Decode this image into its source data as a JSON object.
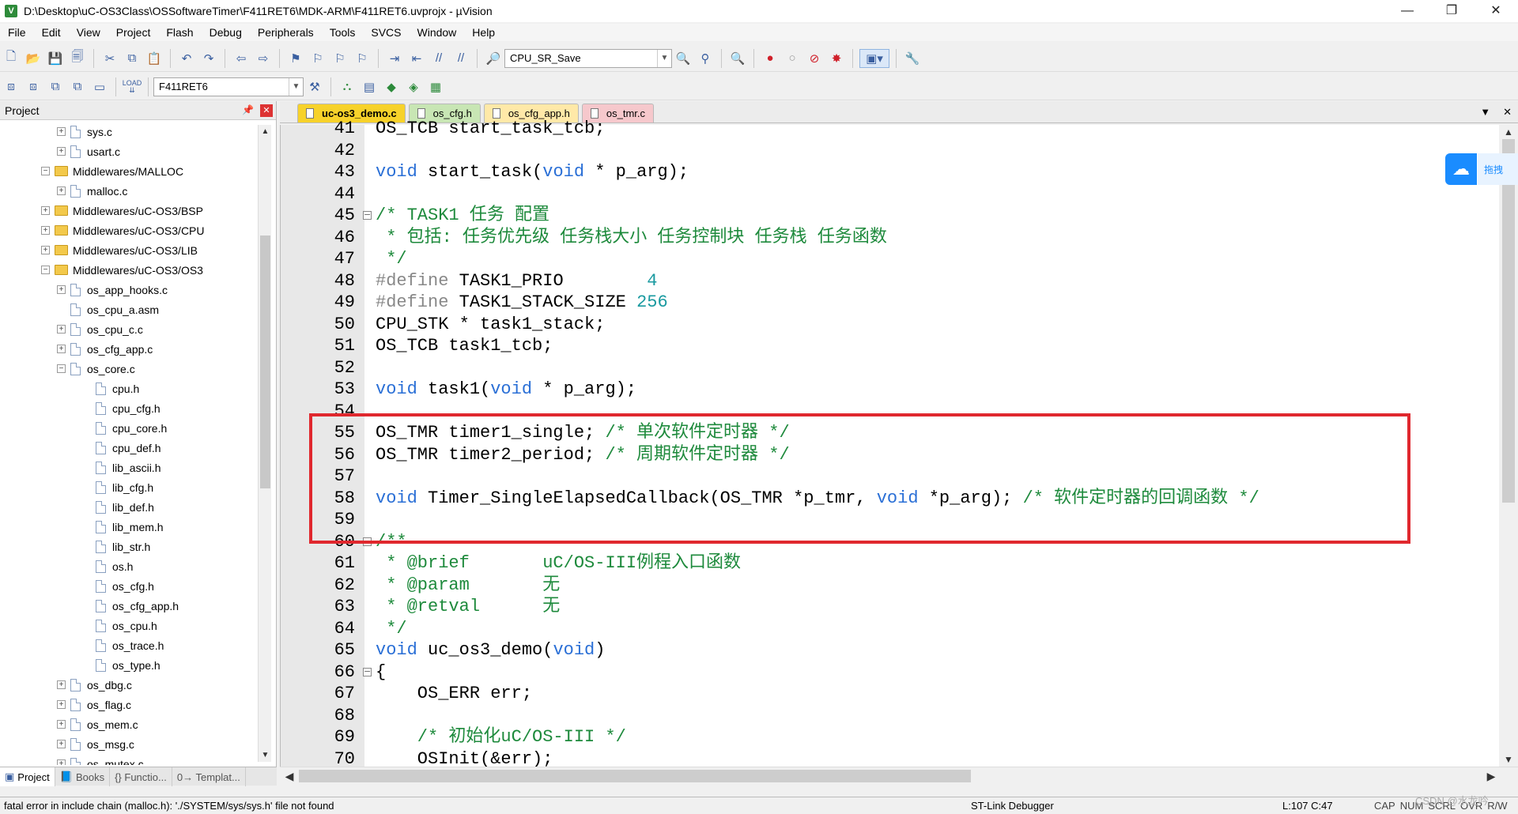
{
  "window": {
    "title": "D:\\Desktop\\uC-OS3Class\\OSSoftwareTimer\\F411RET6\\MDK-ARM\\F411RET6.uvprojx - µVision",
    "minimize": "—",
    "restore": "❐",
    "close": "✕"
  },
  "menu": [
    "File",
    "Edit",
    "View",
    "Project",
    "Flash",
    "Debug",
    "Peripherals",
    "Tools",
    "SVCS",
    "Window",
    "Help"
  ],
  "toolbar": {
    "find_combo_value": "CPU_SR_Save",
    "target_combo_value": "F411RET6",
    "load_label": "LOAD"
  },
  "project_panel": {
    "title": "Project",
    "tree": [
      {
        "label": "sys.c",
        "kind": "file",
        "level": 2,
        "exp": "+"
      },
      {
        "label": "usart.c",
        "kind": "file",
        "level": 2,
        "exp": "+"
      },
      {
        "label": "Middlewares/MALLOC",
        "kind": "folder",
        "level": 1,
        "exp": "-"
      },
      {
        "label": "malloc.c",
        "kind": "file",
        "level": 2,
        "exp": "+"
      },
      {
        "label": "Middlewares/uC-OS3/BSP",
        "kind": "folder",
        "level": 1,
        "exp": "+"
      },
      {
        "label": "Middlewares/uC-OS3/CPU",
        "kind": "folder",
        "level": 1,
        "exp": "+"
      },
      {
        "label": "Middlewares/uC-OS3/LIB",
        "kind": "folder",
        "level": 1,
        "exp": "+"
      },
      {
        "label": "Middlewares/uC-OS3/OS3",
        "kind": "folder",
        "level": 1,
        "exp": "-"
      },
      {
        "label": "os_app_hooks.c",
        "kind": "file",
        "level": 2,
        "exp": "+"
      },
      {
        "label": "os_cpu_a.asm",
        "kind": "file",
        "level": 2,
        "exp": ""
      },
      {
        "label": "os_cpu_c.c",
        "kind": "file",
        "level": 2,
        "exp": "+"
      },
      {
        "label": "os_cfg_app.c",
        "kind": "file",
        "level": 2,
        "exp": "+"
      },
      {
        "label": "os_core.c",
        "kind": "file",
        "level": 2,
        "exp": "-"
      },
      {
        "label": "cpu.h",
        "kind": "file",
        "level": 3,
        "exp": ""
      },
      {
        "label": "cpu_cfg.h",
        "kind": "file",
        "level": 3,
        "exp": ""
      },
      {
        "label": "cpu_core.h",
        "kind": "file",
        "level": 3,
        "exp": ""
      },
      {
        "label": "cpu_def.h",
        "kind": "file",
        "level": 3,
        "exp": ""
      },
      {
        "label": "lib_ascii.h",
        "kind": "file",
        "level": 3,
        "exp": ""
      },
      {
        "label": "lib_cfg.h",
        "kind": "file",
        "level": 3,
        "exp": ""
      },
      {
        "label": "lib_def.h",
        "kind": "file",
        "level": 3,
        "exp": ""
      },
      {
        "label": "lib_mem.h",
        "kind": "file",
        "level": 3,
        "exp": ""
      },
      {
        "label": "lib_str.h",
        "kind": "file",
        "level": 3,
        "exp": ""
      },
      {
        "label": "os.h",
        "kind": "file",
        "level": 3,
        "exp": ""
      },
      {
        "label": "os_cfg.h",
        "kind": "file",
        "level": 3,
        "exp": ""
      },
      {
        "label": "os_cfg_app.h",
        "kind": "file",
        "level": 3,
        "exp": ""
      },
      {
        "label": "os_cpu.h",
        "kind": "file",
        "level": 3,
        "exp": ""
      },
      {
        "label": "os_trace.h",
        "kind": "file",
        "level": 3,
        "exp": ""
      },
      {
        "label": "os_type.h",
        "kind": "file",
        "level": 3,
        "exp": ""
      },
      {
        "label": "os_dbg.c",
        "kind": "file",
        "level": 2,
        "exp": "+"
      },
      {
        "label": "os_flag.c",
        "kind": "file",
        "level": 2,
        "exp": "+"
      },
      {
        "label": "os_mem.c",
        "kind": "file",
        "level": 2,
        "exp": "+"
      },
      {
        "label": "os_msg.c",
        "kind": "file",
        "level": 2,
        "exp": "+"
      },
      {
        "label": "os_mutex.c",
        "kind": "file",
        "level": 2,
        "exp": "+"
      }
    ],
    "tabs": [
      "Project",
      "Books",
      "{} Functio...",
      "0→ Templat..."
    ]
  },
  "editor": {
    "tabs": [
      {
        "label": "uc-os3_demo.c",
        "bg": "#f7d22a",
        "bold": true,
        "active": true
      },
      {
        "label": "os_cfg.h",
        "bg": "#c8e6b4",
        "bold": false,
        "active": false
      },
      {
        "label": "os_cfg_app.h",
        "bg": "#ffe9a8",
        "bold": false,
        "active": false
      },
      {
        "label": "os_tmr.c",
        "bg": "#f6c8cc",
        "bold": false,
        "active": false
      }
    ],
    "lines": [
      {
        "n": "41",
        "fold": "",
        "parts": [
          [
            "",
            "OS_TCB start_task_tcb;"
          ]
        ]
      },
      {
        "n": "42",
        "fold": "",
        "parts": []
      },
      {
        "n": "43",
        "fold": "",
        "parts": [
          [
            "kw",
            "void"
          ],
          [
            "",
            " start_task("
          ],
          [
            "kw",
            "void"
          ],
          [
            "",
            " * p_arg);"
          ]
        ]
      },
      {
        "n": "44",
        "fold": "",
        "parts": []
      },
      {
        "n": "45",
        "fold": "⊟",
        "parts": [
          [
            "cm",
            "/* TASK1 任务 配置"
          ]
        ]
      },
      {
        "n": "46",
        "fold": "",
        "parts": [
          [
            "cm",
            " * 包括: 任务优先级 任务栈大小 任务控制块 任务栈 任务函数"
          ]
        ]
      },
      {
        "n": "47",
        "fold": "",
        "parts": [
          [
            "cm",
            " */"
          ]
        ]
      },
      {
        "n": "48",
        "fold": "",
        "parts": [
          [
            "pp",
            "#define"
          ],
          [
            "",
            " TASK1_PRIO        "
          ],
          [
            "num",
            "4"
          ]
        ]
      },
      {
        "n": "49",
        "fold": "",
        "parts": [
          [
            "pp",
            "#define"
          ],
          [
            "",
            " TASK1_STACK_SIZE "
          ],
          [
            "num",
            "256"
          ]
        ]
      },
      {
        "n": "50",
        "fold": "",
        "parts": [
          [
            "",
            "CPU_STK * task1_stack;"
          ]
        ]
      },
      {
        "n": "51",
        "fold": "",
        "parts": [
          [
            "",
            "OS_TCB task1_tcb;"
          ]
        ]
      },
      {
        "n": "52",
        "fold": "",
        "parts": []
      },
      {
        "n": "53",
        "fold": "",
        "parts": [
          [
            "kw",
            "void"
          ],
          [
            "",
            " task1("
          ],
          [
            "kw",
            "void"
          ],
          [
            "",
            " * p_arg);"
          ]
        ]
      },
      {
        "n": "54",
        "fold": "",
        "parts": []
      },
      {
        "n": "55",
        "fold": "",
        "parts": [
          [
            "",
            "OS_TMR timer1_single; "
          ],
          [
            "cm",
            "/* 单次软件定时器 */"
          ]
        ]
      },
      {
        "n": "56",
        "fold": "",
        "parts": [
          [
            "",
            "OS_TMR timer2_period; "
          ],
          [
            "cm",
            "/* 周期软件定时器 */"
          ]
        ]
      },
      {
        "n": "57",
        "fold": "",
        "parts": []
      },
      {
        "n": "58",
        "fold": "",
        "parts": [
          [
            "kw",
            "void"
          ],
          [
            "",
            " Timer_SingleElapsedCallback(OS_TMR *p_tmr, "
          ],
          [
            "kw",
            "void"
          ],
          [
            "",
            " *p_arg); "
          ],
          [
            "cm",
            "/* 软件定时器的回调函数 */"
          ]
        ]
      },
      {
        "n": "59",
        "fold": "",
        "parts": []
      },
      {
        "n": "60",
        "fold": "⊟",
        "parts": [
          [
            "cm",
            "/**"
          ]
        ]
      },
      {
        "n": "61",
        "fold": "",
        "parts": [
          [
            "cm",
            " * @brief       uC/OS-III例程入口函数"
          ]
        ]
      },
      {
        "n": "62",
        "fold": "",
        "parts": [
          [
            "cm",
            " * @param       无"
          ]
        ]
      },
      {
        "n": "63",
        "fold": "",
        "parts": [
          [
            "cm",
            " * @retval      无"
          ]
        ]
      },
      {
        "n": "64",
        "fold": "",
        "parts": [
          [
            "cm",
            " */"
          ]
        ]
      },
      {
        "n": "65",
        "fold": "",
        "parts": [
          [
            "kw",
            "void"
          ],
          [
            "",
            " uc_os3_demo("
          ],
          [
            "kw",
            "void"
          ],
          [
            "",
            ")"
          ]
        ]
      },
      {
        "n": "66",
        "fold": "⊟",
        "parts": [
          [
            "",
            "{"
          ]
        ]
      },
      {
        "n": "67",
        "fold": "",
        "parts": [
          [
            "",
            "    OS_ERR err;"
          ]
        ]
      },
      {
        "n": "68",
        "fold": "",
        "parts": []
      },
      {
        "n": "69",
        "fold": "",
        "parts": [
          [
            "cm",
            "    /* 初始化uC/OS-III */"
          ]
        ]
      },
      {
        "n": "70",
        "fold": "",
        "parts": [
          [
            "",
            "    OSInit(&err);"
          ]
        ]
      }
    ]
  },
  "baidu_badge": {
    "text": "拖拽"
  },
  "status": {
    "message": "fatal error in include chain (malloc.h): './SYSTEM/sys/sys.h' file not found",
    "debugger": "ST-Link Debugger",
    "position": "L:107 C:47",
    "flags": [
      "CAP",
      "NUM",
      "SCRL",
      "OVR",
      "R/W"
    ]
  },
  "watermark": "CSDN @水龙吟",
  "colors": {
    "highlight_box": "#e0282e",
    "keyword": "#2a6fd6",
    "comment": "#1e8a3c",
    "number": "#1a9aa0"
  }
}
